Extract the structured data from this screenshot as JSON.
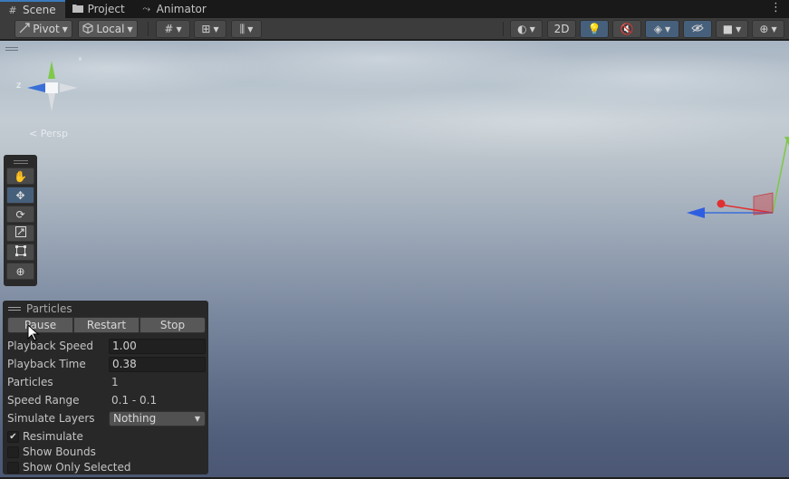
{
  "tabs": [
    {
      "label": "Scene",
      "icon": "scene-grid-icon",
      "active": true
    },
    {
      "label": "Project",
      "icon": "folder-icon",
      "active": false
    },
    {
      "label": "Animator",
      "icon": "animator-icon",
      "active": false
    }
  ],
  "toolbar": {
    "pivot_label": "Pivot",
    "local_label": "Local",
    "mode_2d_label": "2D"
  },
  "scene": {
    "projection_label": "Persp",
    "gizmo_axis_label": "z"
  },
  "tools": [
    "hand-tool",
    "move-tool",
    "rotate-tool",
    "scale-tool",
    "rect-tool",
    "transform-tool"
  ],
  "particles": {
    "title": "Particles",
    "buttons": {
      "pause": "Pause",
      "restart": "Restart",
      "stop": "Stop"
    },
    "playback_speed": {
      "label": "Playback Speed",
      "value": "1.00"
    },
    "playback_time": {
      "label": "Playback Time",
      "value": "0.38"
    },
    "particles_count": {
      "label": "Particles",
      "value": "1"
    },
    "speed_range": {
      "label": "Speed Range",
      "value": "0.1 - 0.1"
    },
    "simulate_layers": {
      "label": "Simulate Layers",
      "value": "Nothing"
    },
    "resimulate": {
      "label": "Resimulate",
      "checked": true
    },
    "show_bounds": {
      "label": "Show Bounds",
      "checked": false
    },
    "show_only_selected": {
      "label": "Show Only Selected",
      "checked": false
    }
  },
  "colors": {
    "accent_blue": "#3a79bb",
    "active_tool": "#46607c",
    "panel_bg": "#282828",
    "toolbar_bg": "#3c3c3c"
  }
}
